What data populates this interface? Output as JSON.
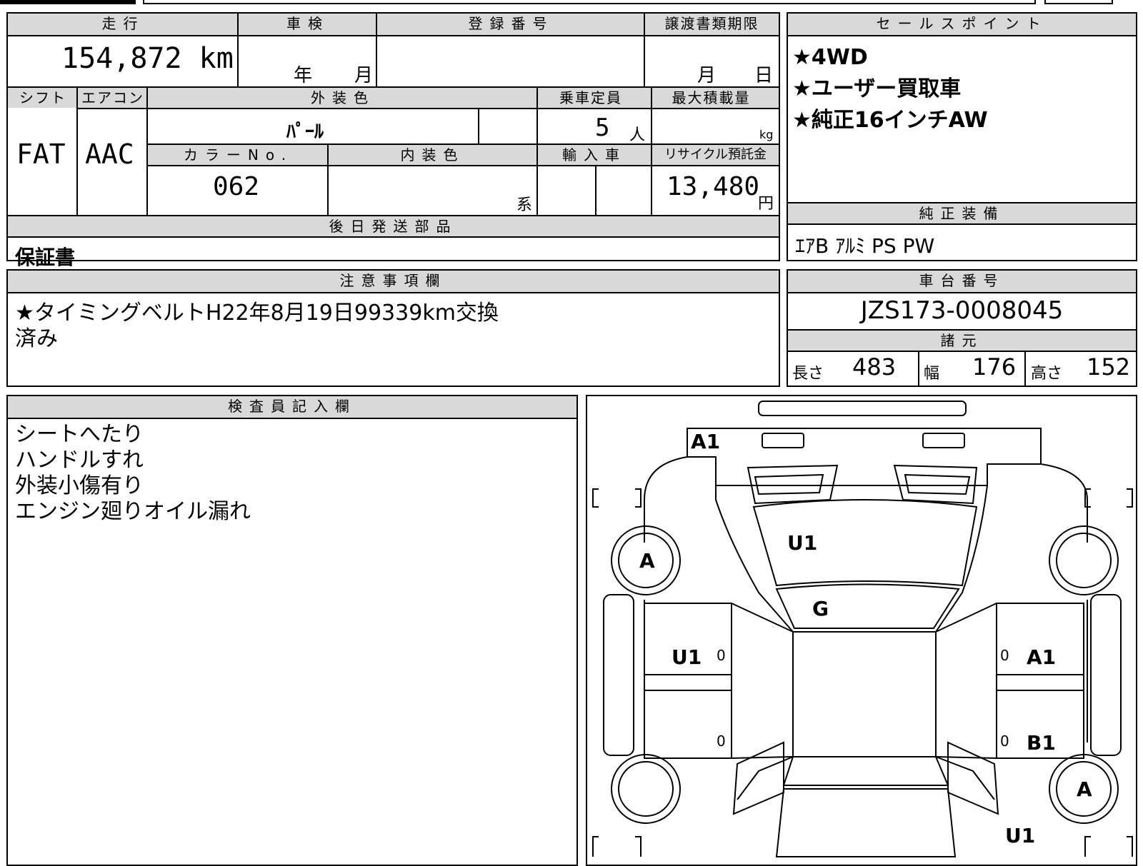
{
  "mileage": {
    "label": "走行",
    "value": "154,872 km"
  },
  "inspection": {
    "label": "車検",
    "year_unit": "年",
    "month_unit": "月"
  },
  "registration": {
    "label": "登録番号"
  },
  "transfer": {
    "label": "譲渡書類期限",
    "month_unit": "月",
    "day_unit": "日"
  },
  "shift": {
    "label": "シフト",
    "value": "FAT"
  },
  "aircon": {
    "label": "エアコン",
    "value": "AAC"
  },
  "exterior": {
    "label": "外装色",
    "value": "ﾊﾟｰﾙ"
  },
  "capacity": {
    "label": "乗車定員",
    "value": "5",
    "unit": "人"
  },
  "max_load": {
    "label": "最大積載量",
    "unit": "kg"
  },
  "color_no": {
    "label": "カラーNo.",
    "value": "062"
  },
  "interior": {
    "label": "内装色",
    "suffix": "系"
  },
  "import": {
    "label": "輸入車"
  },
  "recycle": {
    "label": "リサイクル預託金",
    "value": "13,480",
    "unit": "円"
  },
  "later_parts": {
    "label": "後日発送部品",
    "value": "保証書"
  },
  "sales_points": {
    "label": "セールスポイント",
    "items": [
      "★4WD",
      "★ユーザー買取車",
      "★純正16インチAW"
    ]
  },
  "factory_equipment": {
    "label": "純正装備",
    "value": "ｴｱB ｱﾙﾐ PS PW"
  },
  "notes": {
    "label": "注意事項欄",
    "line1": "★タイミングベルトH22年8月19日99339km交換",
    "line2": "済み"
  },
  "chassis": {
    "label": "車台番号",
    "value": "JZS173-0008045"
  },
  "dimensions": {
    "label": "諸元",
    "length_label": "長さ",
    "length": "483",
    "width_label": "幅",
    "width": "176",
    "height_label": "高さ",
    "height": "152"
  },
  "inspector": {
    "label": "検査員記入欄",
    "lines": [
      "シートへたり",
      "ハンドルすれ",
      "外装小傷有り",
      "エンジン廻りオイル漏れ"
    ]
  },
  "diagram_marks": {
    "a1_top": "A1",
    "u1_roof": "U1",
    "g_glass": "G",
    "a_front_left": "A",
    "u1_left": "U1",
    "zero_left_1": "0",
    "zero_left_2": "0",
    "zero_right_1": "0",
    "a1_right": "A1",
    "zero_right_2": "0",
    "b1_right": "B1",
    "a_rear_right": "A",
    "u1_rear_right": "U1"
  },
  "colors": {
    "header_bg": "#d9d9d9",
    "border": "#000000"
  }
}
